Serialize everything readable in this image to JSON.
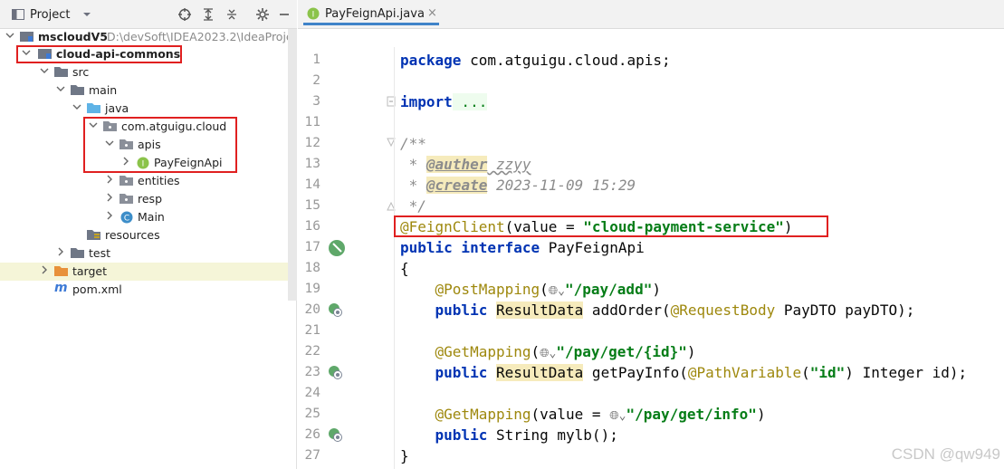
{
  "project": {
    "title": "Project",
    "tree": [
      {
        "label": "mscloudV5",
        "extra": "D:\\devSoft\\IDEA2023.2\\IdeaProje"
      },
      {
        "label": "cloud-api-commons"
      },
      {
        "label": "src"
      },
      {
        "label": "main"
      },
      {
        "label": "java"
      },
      {
        "label": "com.atguigu.cloud"
      },
      {
        "label": "apis"
      },
      {
        "label": "PayFeignApi"
      },
      {
        "label": "entities"
      },
      {
        "label": "resp"
      },
      {
        "label": "Main"
      },
      {
        "label": "resources"
      },
      {
        "label": "test"
      },
      {
        "label": "target"
      },
      {
        "label": "pom.xml"
      }
    ]
  },
  "editor": {
    "tab_label": "PayFeignApi.java",
    "line_numbers": [
      "1",
      "2",
      "3",
      "11",
      "12",
      "13",
      "14",
      "15",
      "16",
      "17",
      "18",
      "19",
      "20",
      "21",
      "22",
      "23",
      "24",
      "25",
      "26",
      "27"
    ],
    "lines": {
      "l1_kw": "package",
      "l1_rest": " com.atguigu.cloud.apis;",
      "l3_kw": "import",
      "l3_rest": " ...",
      "l12": "/**",
      "l13_a": " * ",
      "l13_b": "@auther",
      "l13_c": " zzyy",
      "l14_a": " * ",
      "l14_b": "@create",
      "l14_c": " 2023-11-09 15:29",
      "l15": " */",
      "l16_a": "@FeignClient",
      "l16_b": "(value = ",
      "l16_c": "\"cloud-payment-service\"",
      "l16_d": ")",
      "l17_a": "public interface",
      "l17_b": " PayFeignApi",
      "l18": "{",
      "l19_a": "    @PostMapping",
      "l19_b": "(",
      "l19_c": "\"/pay/add\"",
      "l19_d": ")",
      "l20_a": "    public ",
      "l20_b": "ResultData",
      "l20_c": " addOrder(",
      "l20_d": "@RequestBody",
      "l20_e": " PayDTO payDTO);",
      "l22_a": "    @GetMapping",
      "l22_b": "(",
      "l22_c": "\"/pay/get/{id}\"",
      "l22_d": ")",
      "l23_a": "    public ",
      "l23_b": "ResultData",
      "l23_c": " getPayInfo(",
      "l23_d": "@PathVariable",
      "l23_e": "(",
      "l23_f": "\"id\"",
      "l23_g": ") Integer id);",
      "l25_a": "    @GetMapping",
      "l25_b": "(value = ",
      "l25_c": "\"/pay/get/info\"",
      "l25_d": ")",
      "l26_a": "    public ",
      "l26_b": "String mylb();",
      "l27": "}"
    }
  },
  "watermark": "CSDN @qw949",
  "colors": {
    "keyword": "#0033b3",
    "annotation": "#9e880d",
    "string": "#067d17",
    "highlight_box": "#e02020"
  }
}
